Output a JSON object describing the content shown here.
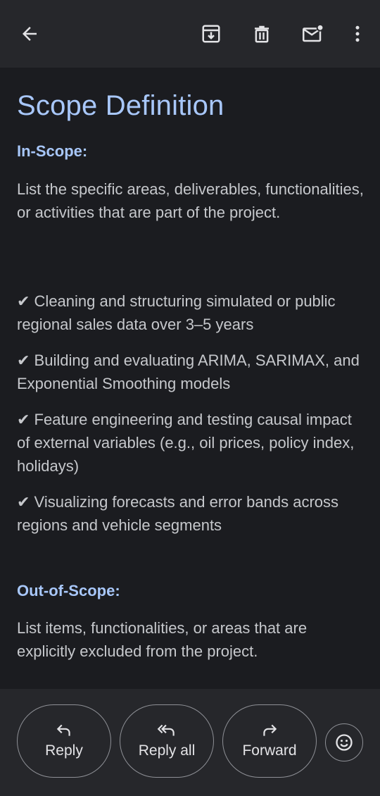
{
  "toolbar": {
    "back_icon": "arrow-back-icon",
    "archive_icon": "archive-icon",
    "delete_icon": "delete-icon",
    "mark_unread_icon": "mark-unread-icon",
    "more_icon": "more-vert-icon"
  },
  "email": {
    "title": "Scope Definition",
    "in_scope": {
      "heading": "In-Scope:",
      "intro": "List the specific areas, deliverables, functionalities, or activities that are part of the project.",
      "items": [
        "Cleaning and structuring simulated or public regional sales data over 3–5 years",
        "Building and evaluating ARIMA, SARIMAX, and Exponential Smoothing models",
        "Feature engineering and testing causal impact of external variables (e.g., oil prices, policy index, holidays)",
        "Visualizing forecasts and error bands across regions and vehicle segments"
      ]
    },
    "out_of_scope": {
      "heading": "Out-of-Scope:",
      "intro": "List items, functionalities, or areas that are explicitly excluded from the project."
    }
  },
  "actions": {
    "reply_label": "Reply",
    "reply_all_label": "Reply all",
    "forward_label": "Forward",
    "emoji_icon": "add-reaction-icon"
  },
  "colors": {
    "accent": "#a8c7fa",
    "background": "#1b1c20",
    "bar": "#26272b",
    "text": "#c6c8cc"
  }
}
